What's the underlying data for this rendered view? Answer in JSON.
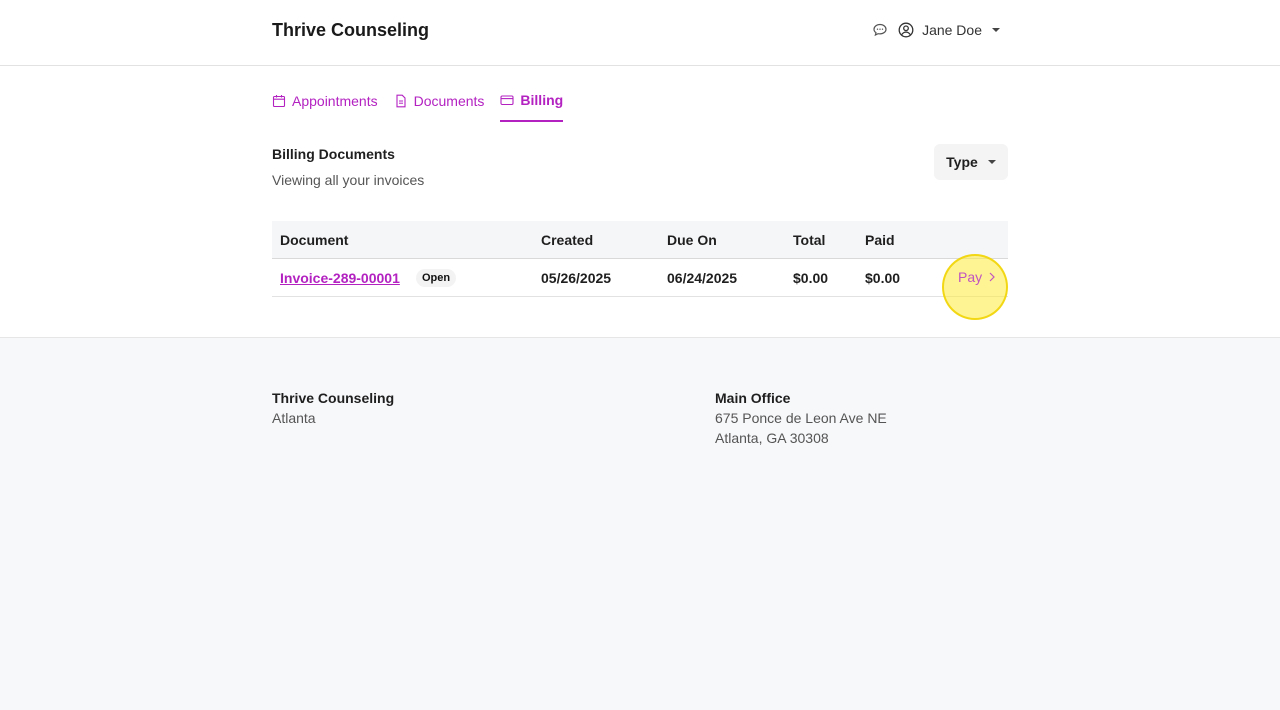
{
  "header": {
    "brand": "Thrive Counseling",
    "user_name": "Jane Doe"
  },
  "tabs": [
    {
      "label": "Appointments",
      "icon": "calendar-icon"
    },
    {
      "label": "Documents",
      "icon": "document-icon"
    },
    {
      "label": "Billing",
      "icon": "credit-card-icon",
      "active": true
    }
  ],
  "billing": {
    "title": "Billing Documents",
    "subtitle": "Viewing all your invoices",
    "type_button": "Type"
  },
  "table": {
    "headers": [
      "Document",
      "Created",
      "Due On",
      "Total",
      "Paid"
    ],
    "rows": [
      {
        "document": "Invoice-289-00001",
        "status": "Open",
        "created": "05/26/2025",
        "due_on": "06/24/2025",
        "total": "$0.00",
        "paid": "$0.00",
        "action": "Pay"
      }
    ]
  },
  "footer": {
    "left": {
      "name": "Thrive Counseling",
      "city": "Atlanta"
    },
    "right": {
      "title": "Main Office",
      "line1": "675 Ponce de Leon Ave NE",
      "line2": "Atlanta, GA 30308"
    }
  },
  "colors": {
    "accent": "#b322c1",
    "highlight": "#ffeb3b"
  }
}
